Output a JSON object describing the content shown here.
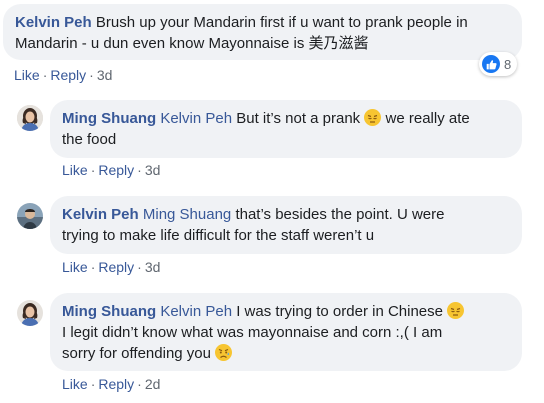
{
  "comments": [
    {
      "author": "Kelvin Peh",
      "text": "Brush up your Mandarin first if u want to prank people in Mandarin - u dun even know Mayonnaise is 美乃滋酱",
      "line1": "Brush up your Mandarin first if u want to prank people in",
      "line2": "Mandarin - u dun even know Mayonnaise is 美乃滋酱",
      "like": "Like",
      "reply": "Reply",
      "time": "3d",
      "reaction_count": "8",
      "reaction_icon": "like-icon"
    },
    {
      "author": "Ming Shuang",
      "mention": "Kelvin Peh",
      "text_a": "But it’s not a prank",
      "emoji_a": "pensive-face-emoji",
      "text_b": "we really ate",
      "text_c": "the food",
      "like": "Like",
      "reply": "Reply",
      "time": "3d"
    },
    {
      "author": "Kelvin Peh",
      "mention": "Ming Shuang",
      "text_a": "that’s besides the point. U were",
      "text_b": "trying to make life difficult for the staff weren’t u",
      "like": "Like",
      "reply": "Reply",
      "time": "3d"
    },
    {
      "author": "Ming Shuang",
      "mention": "Kelvin Peh",
      "text_a": "I was trying to order in Chinese",
      "emoji_a": "pensive-face-emoji",
      "text_b": "I legit didn’t know what was mayonnaise and corn :,( I am",
      "text_c": "sorry for offending you",
      "emoji_c": "disappointed-face-emoji",
      "like": "Like",
      "reply": "Reply",
      "time": "2d"
    }
  ],
  "colors": {
    "name": "#385898",
    "bubble": "#f0f2f5",
    "meta": "#606770",
    "like_badge": "#1877f2"
  }
}
